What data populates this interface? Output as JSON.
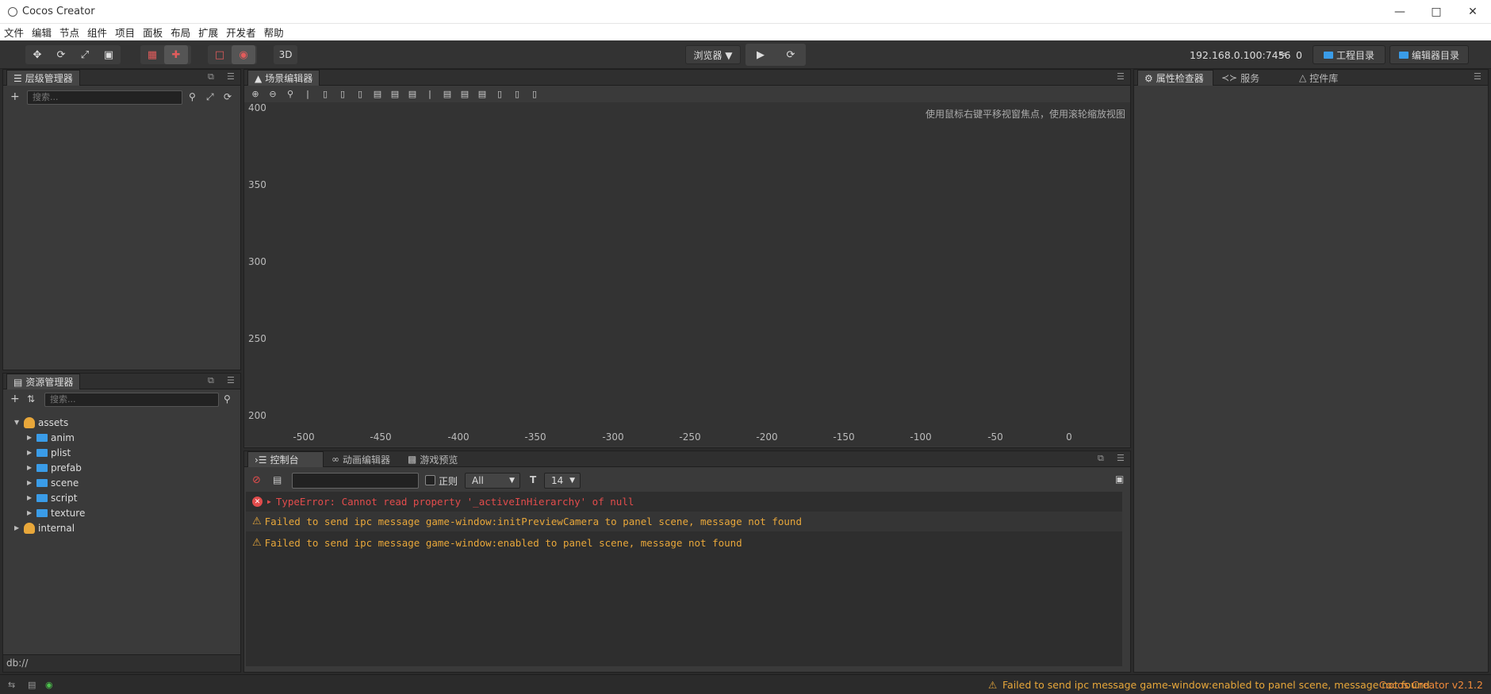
{
  "window": {
    "title": "Cocos Creator"
  },
  "menu": [
    "文件",
    "编辑",
    "节点",
    "组件",
    "项目",
    "面板",
    "布局",
    "扩展",
    "开发者",
    "帮助"
  ],
  "toolbar": {
    "mode_3d": "3D",
    "browser_select": "浏览器 ▼",
    "ip": "192.168.0.100:7456",
    "device_count": "0",
    "project_dir": "工程目录",
    "editor_dir": "编辑器目录"
  },
  "hierarchy": {
    "title": "层级管理器",
    "search_placeholder": "搜索..."
  },
  "assets": {
    "title": "资源管理器",
    "search_placeholder": "搜索...",
    "root": "assets",
    "folders": [
      "anim",
      "plist",
      "prefab",
      "scene",
      "script",
      "texture"
    ],
    "internal": "internal",
    "footer": "db://"
  },
  "scene": {
    "title": "场景编辑器",
    "hint": "使用鼠标右键平移视窗焦点，使用滚轮缩放视图",
    "y_ticks": [
      "400",
      "350",
      "300",
      "250",
      "200"
    ],
    "x_ticks": [
      "-500",
      "-450",
      "-400",
      "-350",
      "-300",
      "-250",
      "-200",
      "-150",
      "-100",
      "-50",
      "0"
    ]
  },
  "console": {
    "tabs": {
      "console": "控制台",
      "animation": "动画编辑器",
      "preview": "游戏预览"
    },
    "regex_label": "正则",
    "level_select": "All",
    "font_size": "14",
    "logs": [
      {
        "type": "error",
        "text": "TypeError: Cannot read property '_activeInHierarchy' of null"
      },
      {
        "type": "warn",
        "text": "Failed to send ipc message game-window:initPreviewCamera to panel scene, message not found"
      },
      {
        "type": "warn",
        "text": "Failed to send ipc message game-window:enabled to panel scene, message not found"
      }
    ]
  },
  "inspector": {
    "tabs": {
      "properties": "属性检查器",
      "services": "服务",
      "widgets": "控件库"
    }
  },
  "status": {
    "message": "Failed to send ipc message game-window:enabled to panel scene, message not found",
    "version": "Cocos Creator v2.1.2"
  },
  "colors": {
    "error": "#e24c4c",
    "warning": "#e8a73a",
    "version": "#f08a3a",
    "folder": "#3a9ce8"
  }
}
